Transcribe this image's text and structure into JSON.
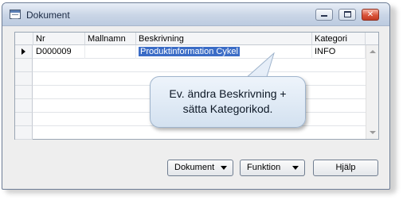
{
  "window": {
    "title": "Dokument",
    "icon": "document-list-icon"
  },
  "grid": {
    "columns": [
      "Nr",
      "Mallnamn",
      "Beskrivning",
      "Kategori"
    ],
    "rows": [
      {
        "nr": "D000009",
        "mallnamn": "",
        "beskrivning": "Produktinformation Cykel",
        "kategori": "INFO",
        "current": true
      }
    ],
    "empty_rows": 6
  },
  "tooltip": {
    "line1": "Ev. ändra Beskrivning +",
    "line2": "sätta Kategorikod."
  },
  "buttons": {
    "dokument": "Dokument",
    "funktion": "Funktion",
    "hjalp": "Hjälp"
  },
  "colors": {
    "selection": "#3b6cc6",
    "titlebar": "#c9d5e6",
    "close_button": "#d9543a"
  }
}
